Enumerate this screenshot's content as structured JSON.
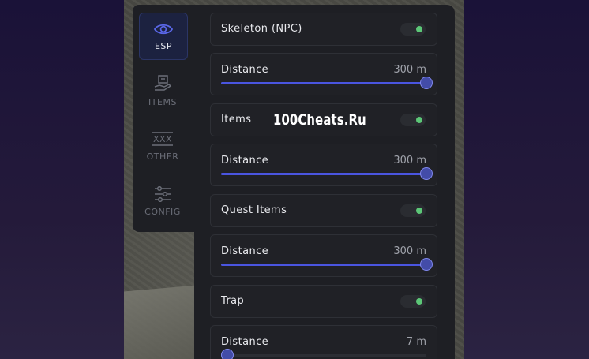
{
  "nav": [
    {
      "label": "ESP",
      "icon": "eye-icon",
      "active": true
    },
    {
      "label": "ITEMS",
      "icon": "hand-box-icon",
      "active": false
    },
    {
      "label": "OTHER",
      "icon": "xxx-icon",
      "active": false
    },
    {
      "label": "CONFIG",
      "icon": "sliders-icon",
      "active": false
    }
  ],
  "rows": [
    {
      "type": "toggle",
      "label": "Skeleton (NPC)",
      "on": true
    },
    {
      "type": "slider",
      "label": "Distance",
      "value": "300 m",
      "fraction": 1.0
    },
    {
      "type": "toggle",
      "label": "Items",
      "on": true
    },
    {
      "type": "slider",
      "label": "Distance",
      "value": "300 m",
      "fraction": 1.0
    },
    {
      "type": "toggle",
      "label": "Quest Items",
      "on": true
    },
    {
      "type": "slider",
      "label": "Distance",
      "value": "300 m",
      "fraction": 1.0
    },
    {
      "type": "toggle",
      "label": "Trap",
      "on": true
    },
    {
      "type": "slider",
      "label": "Distance",
      "value": "7 m",
      "fraction": 0.0
    }
  ],
  "watermark": "100Cheats.Ru",
  "colors": {
    "accent": "#4a55e0",
    "toggle_on": "#5cc777",
    "panel": "#1e1f24"
  }
}
